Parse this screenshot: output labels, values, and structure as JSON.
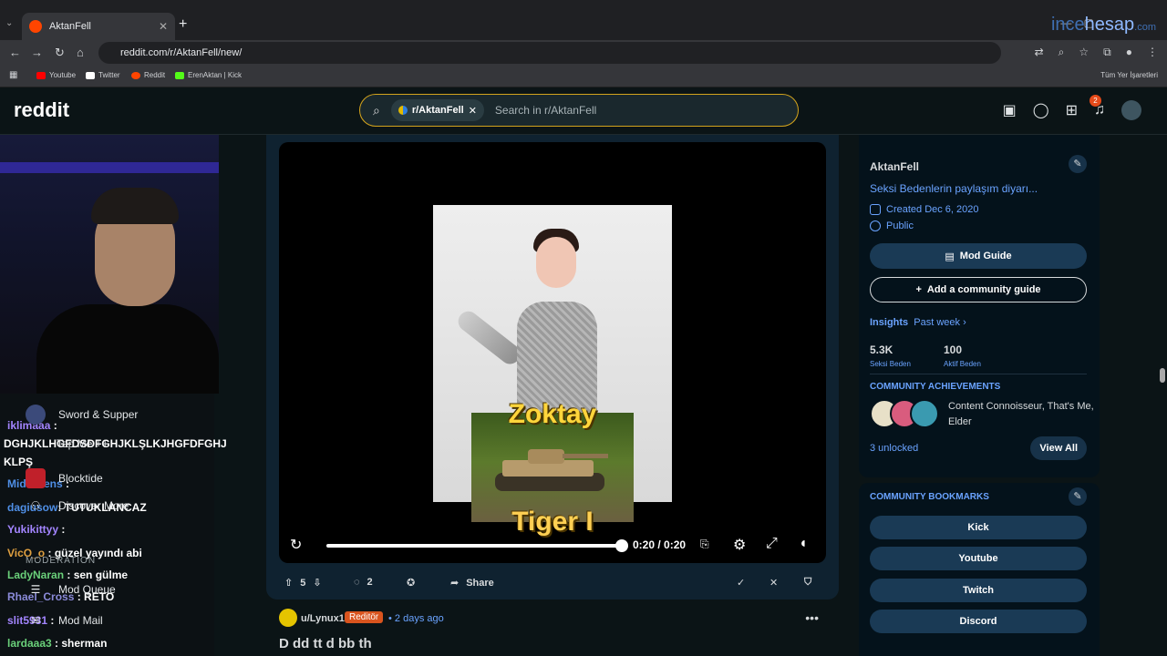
{
  "browser": {
    "tab_title": "AktanFell",
    "tab_close": "✕",
    "new_tab": "+",
    "url": "reddit.com/r/AktanFell/new/",
    "watermark_a": "ince",
    "watermark_b": "hesap",
    "watermark_c": ".com",
    "bookmarks": [
      "Youtube",
      "Twitter",
      "Reddit",
      "ErenAktan | Kick"
    ],
    "bookmarks_right": "Tüm Yer İşaretleri"
  },
  "header": {
    "logo": "reddit",
    "search_chip": "r/AktanFell",
    "search_placeholder": "Search in r/AktanFell",
    "notification_count": "2"
  },
  "chat": [
    {
      "user": "iklimaaa",
      "msg": ":"
    },
    {
      "user": "",
      "msg": "DGHJKLHGFDSDFGHJKLŞLKJHGFDFGHJ"
    },
    {
      "user": "",
      "msg": "KLPŞ"
    },
    {
      "user": "Midlewens",
      "msg": ":"
    },
    {
      "user": "dagiusow",
      "msg": ": TUTUKLANCAZ"
    },
    {
      "user": "Yukikittyy",
      "msg": ":"
    },
    {
      "user": "VicO_o",
      "msg": ": güzel yayındı abi"
    },
    {
      "user": "LadyNaran",
      "msg": ": sen gülme"
    },
    {
      "user": "Rhael_Cross",
      "msg": ": RETO"
    },
    {
      "user": "slit5931",
      "msg": ":"
    },
    {
      "user": "lardaaa3",
      "msg": ": sherman"
    }
  ],
  "left_nav": {
    "items": [
      "Sword & Supper",
      "Tap Me ++",
      "Blocktide",
      "Discover More"
    ],
    "moderation_label": "MODERATION",
    "mod_items": [
      "Mod Queue",
      "Mod Mail"
    ]
  },
  "video": {
    "overlay_top": "Zoktay",
    "overlay_bottom": "Tiger I",
    "time": "0:20 / 0:20",
    "progress": 1.0
  },
  "post_actions": {
    "votes": "5",
    "comments": "2",
    "share": "Share"
  },
  "comment": {
    "user": "u/Lynux1",
    "flair": "Reditör",
    "time": "• 2 days ago",
    "text_partial": "D        dd       tt  d    bb  th"
  },
  "sidebar": {
    "name": "AktanFell",
    "description": "Seksi Bedenlerin paylaşım diyarı...",
    "created": "Created Dec 6, 2020",
    "visibility": "Public",
    "mod_guide": "Mod Guide",
    "add_guide": "Add a community guide",
    "insights": "Insights",
    "insights_period": "Past week",
    "members_value": "5.3K",
    "members_label": "Seksi Beden",
    "active_value": "100",
    "active_label": "Aktif Beden",
    "achievements_title": "COMMUNITY ACHIEVEMENTS",
    "achievements_text": "Content Connoisseur, That's Me, Elder",
    "unlocked": "3 unlocked",
    "view_all": "View All",
    "bookmarks_title": "COMMUNITY BOOKMARKS",
    "bookmarks": [
      "Kick",
      "Youtube",
      "Twitch",
      "Discord"
    ]
  },
  "colors": {
    "accent_blue": "#6aa3ff",
    "reddit_orange": "#ff4500",
    "overlay_yellow": "#ffd53b"
  }
}
